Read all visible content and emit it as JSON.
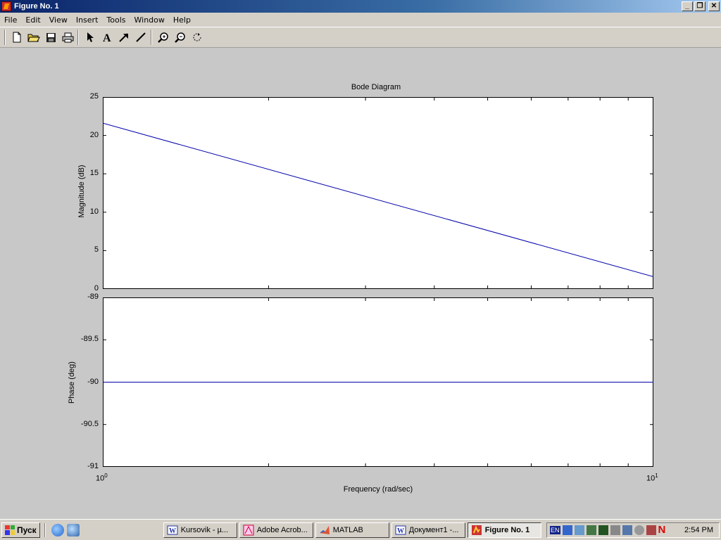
{
  "window": {
    "title": "Figure No. 1"
  },
  "menu": [
    "File",
    "Edit",
    "View",
    "Insert",
    "Tools",
    "Window",
    "Help"
  ],
  "toolbar": {
    "icons": [
      "new-file-icon",
      "open-folder-icon",
      "save-icon",
      "print-icon",
      "select-arrow-icon",
      "insert-text-icon",
      "insert-arrow-icon",
      "insert-line-icon",
      "zoom-in-icon",
      "zoom-out-icon",
      "rotate-3d-icon"
    ]
  },
  "plot": {
    "title": "Bode Diagram",
    "xlabel": "Frequency  (rad/sec)",
    "x_tick_base": "10",
    "x_ticks": [
      {
        "exp": "0"
      },
      {
        "exp": "1"
      }
    ]
  },
  "chart_data": [
    {
      "type": "line",
      "title": "Bode Diagram",
      "ylabel": "Magnitude (dB)",
      "xscale": "log",
      "xlim": [
        1,
        10
      ],
      "ylim": [
        0,
        25
      ],
      "yticks": [
        "0",
        "5",
        "10",
        "15",
        "20",
        "25"
      ],
      "series": [
        {
          "x": [
            1,
            10
          ],
          "values": [
            21.6,
            1.6
          ]
        }
      ],
      "color": "#0000aa"
    },
    {
      "type": "line",
      "ylabel": "Phase (deg)",
      "xlabel": "Frequency  (rad/sec)",
      "xscale": "log",
      "xlim": [
        1,
        10
      ],
      "ylim": [
        -91,
        -89
      ],
      "yticks": [
        "-91",
        "-90.5",
        "-90",
        "-89.5",
        "-89"
      ],
      "series": [
        {
          "x": [
            1,
            10
          ],
          "values": [
            -90,
            -90
          ]
        }
      ],
      "color": "#0000aa"
    }
  ],
  "taskbar": {
    "start_label": "Пуск",
    "quick_launch": [
      "ie-icon",
      "outlook-icon"
    ],
    "tasks": [
      {
        "label": "Kursovik - µ...",
        "icon": "word-icon",
        "active": false
      },
      {
        "label": "Adobe Acrob...",
        "icon": "acrobat-icon",
        "active": false
      },
      {
        "label": "MATLAB",
        "icon": "matlab-icon",
        "active": false
      },
      {
        "label": "Документ1 -...",
        "icon": "word-icon",
        "active": false
      },
      {
        "label": "Figure No. 1",
        "icon": "matlab-figure-icon",
        "active": true
      }
    ],
    "tray_lang": "EN",
    "clock": "2:54 PM"
  }
}
